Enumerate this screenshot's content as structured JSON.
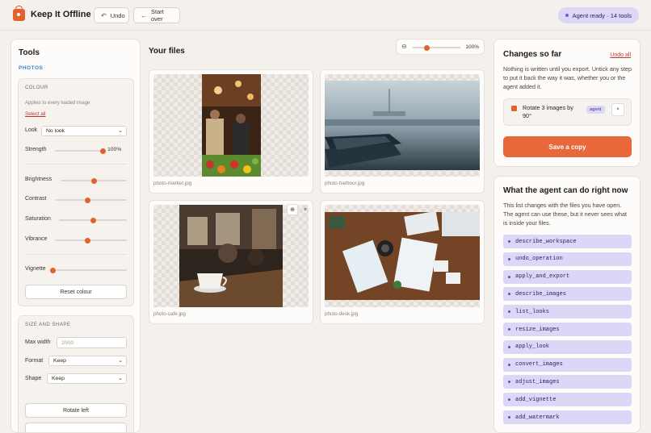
{
  "header": {
    "app_title": "Keep It Offline",
    "undo_label": "Undo",
    "start_over_label": "Start over",
    "agent_status": "Agent ready · 14 tools"
  },
  "tools": {
    "title": "Tools",
    "section": "PHOTOS",
    "colour": {
      "title": "COLOUR",
      "note": "Applies to every loaded image",
      "select_all": "Select all",
      "look_label": "Look",
      "look_value": "No look",
      "strength_label": "Strength",
      "strength_value": "100%",
      "strength_level": 1.0,
      "brightness_label": "Brightness",
      "brightness_level": 0.5,
      "contrast_label": "Contrast",
      "contrast_level": 0.45,
      "saturation_label": "Saturation",
      "saturation_level": 0.5,
      "vibrance_label": "Vibrance",
      "vibrance_level": 0.45,
      "vignette_label": "Vignette",
      "vignette_level": 0.0,
      "reset_label": "Reset colour"
    },
    "size": {
      "title": "SIZE AND SHAPE",
      "max_width_label": "Max width",
      "max_width_placeholder": "2000",
      "format_label": "Format",
      "format_value": "Keep",
      "shape_label": "Shape",
      "shape_value": "Keep",
      "rotate_left_label": "Rotate left"
    }
  },
  "files": {
    "title": "Your files",
    "zoom_value": "100%",
    "zoom_level": 0.3,
    "items": [
      {
        "name": "photo-market.jpg"
      },
      {
        "name": "photo-harbour.jpg"
      },
      {
        "name": "photo-cafe.jpg"
      },
      {
        "name": "photo-desk.jpg"
      }
    ]
  },
  "changes": {
    "title": "Changes so far",
    "undo_all": "Undo all",
    "description": "Nothing is written until you export. Untick any step to put it back the way it was, whether you or the agent added it.",
    "items": [
      {
        "text": "Rotate 3 images by 90°",
        "badge": "agent",
        "checked": true
      }
    ],
    "save_label": "Save a copy"
  },
  "capabilities": {
    "title": "What the agent can do right now",
    "description": "This list changes with the files you have open. The agent can use these, but it never sees what is inside your files.",
    "tools": [
      "describe_workspace",
      "undo_operation",
      "apply_and_export",
      "describe_images",
      "list_looks",
      "resize_images",
      "apply_look",
      "convert_images",
      "adjust_images",
      "add_vignette",
      "add_watermark"
    ]
  },
  "colors": {
    "accent": "#e3612c",
    "agent_purple": "#ddd7f7",
    "link_red": "#c0392b",
    "section_blue": "#3c7fc9"
  }
}
